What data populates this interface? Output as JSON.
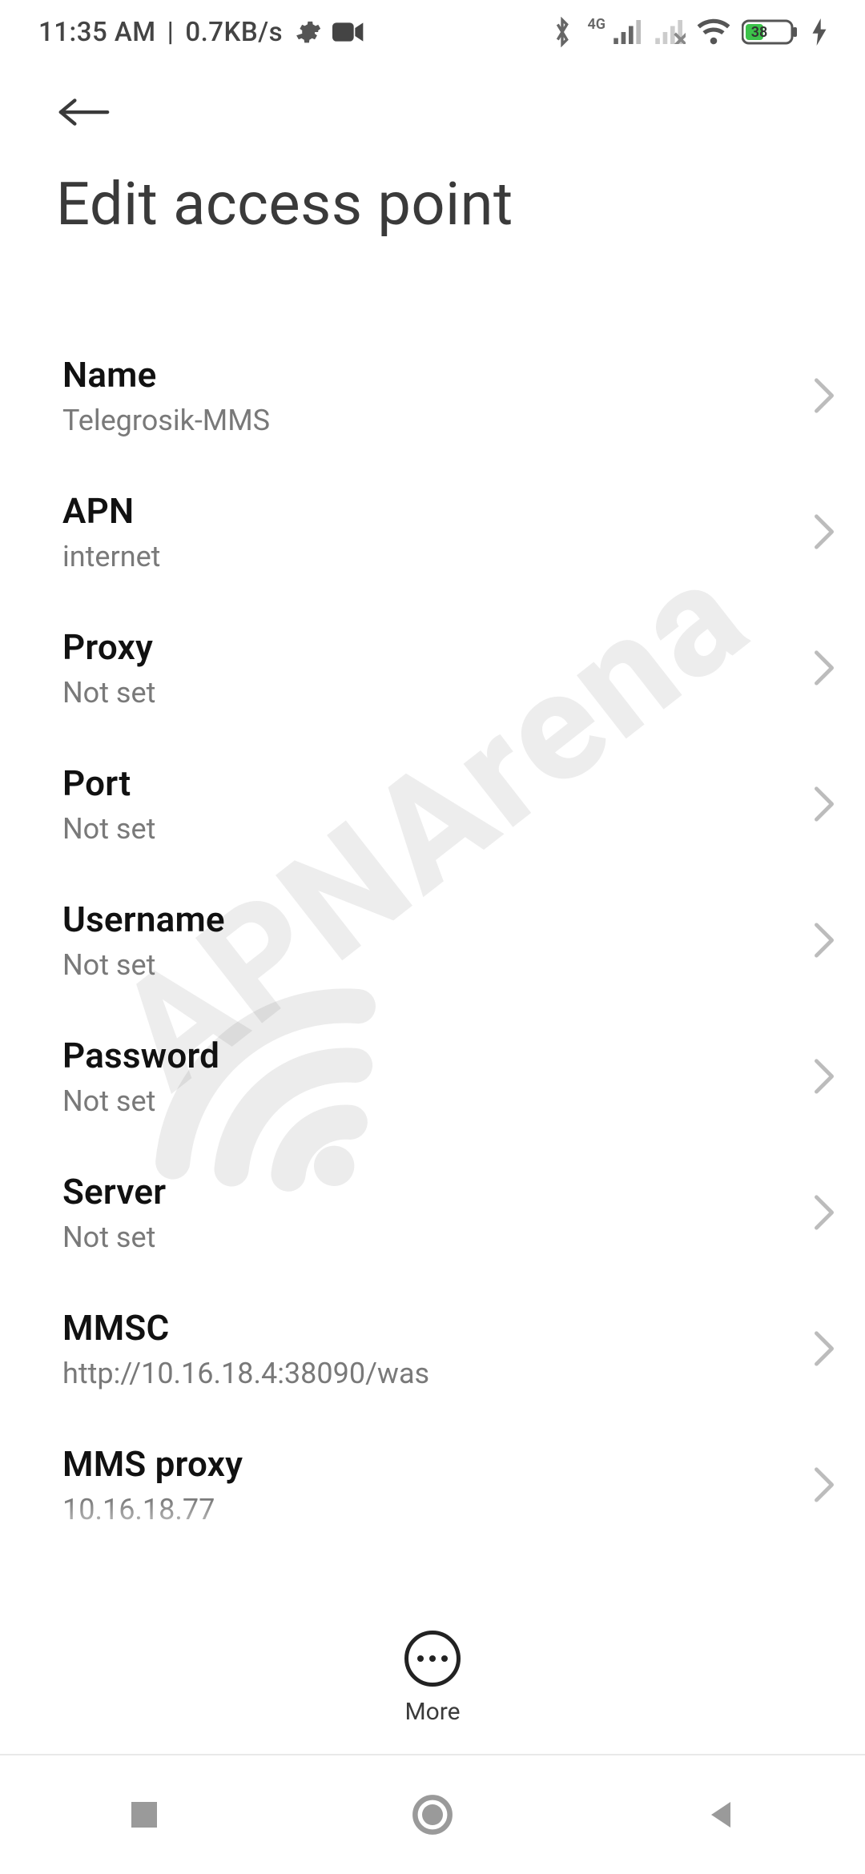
{
  "status": {
    "time": "11:35 AM",
    "separator": "|",
    "net_speed": "0.7KB/s",
    "battery_pct": "38"
  },
  "header": {
    "title": "Edit access point"
  },
  "settings": {
    "name": {
      "label": "Name",
      "value": "Telegrosik-MMS"
    },
    "apn": {
      "label": "APN",
      "value": "internet"
    },
    "proxy": {
      "label": "Proxy",
      "value": "Not set"
    },
    "port": {
      "label": "Port",
      "value": "Not set"
    },
    "username": {
      "label": "Username",
      "value": "Not set"
    },
    "password": {
      "label": "Password",
      "value": "Not set"
    },
    "server": {
      "label": "Server",
      "value": "Not set"
    },
    "mmsc": {
      "label": "MMSC",
      "value": "http://10.16.18.4:38090/was"
    },
    "mmsproxy": {
      "label": "MMS proxy",
      "value": "10.16.18.77"
    }
  },
  "actions": {
    "more_label": "More"
  },
  "watermark": "APNArena"
}
